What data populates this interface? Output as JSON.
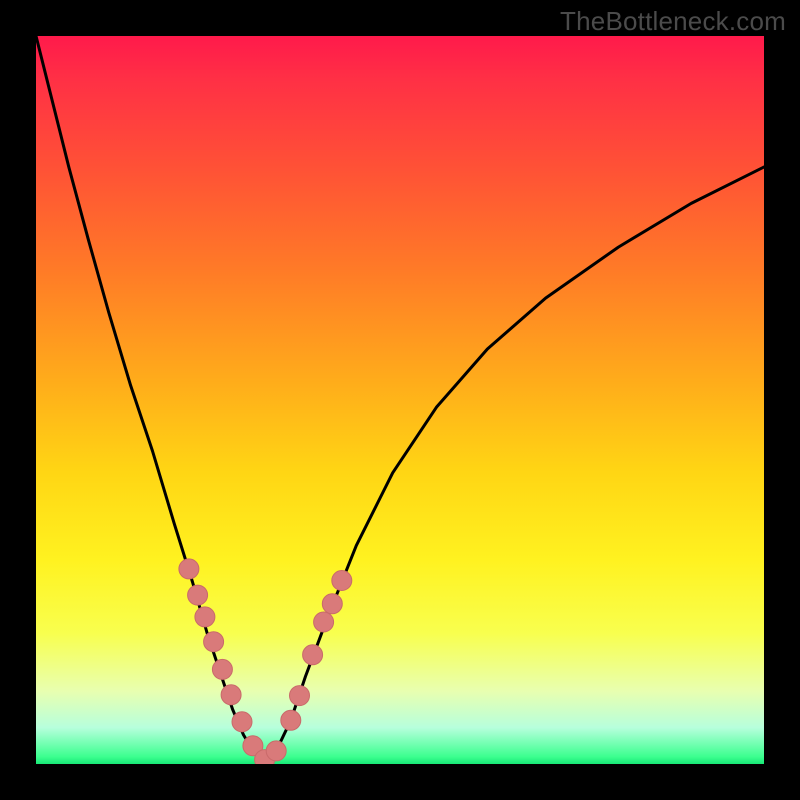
{
  "watermark": "TheBottleneck.com",
  "colors": {
    "page_bg": "#000000",
    "curve": "#000000",
    "marker_fill": "#d97a7a",
    "marker_stroke": "#c96a6a",
    "gradient_top": "#ff1a4b",
    "gradient_mid": "#ffe22e",
    "gradient_bottom": "#18e876"
  },
  "chart_data": {
    "type": "line",
    "title": "",
    "xlabel": "",
    "ylabel": "",
    "xlim": [
      0,
      1
    ],
    "ylim": [
      0,
      1
    ],
    "series": [
      {
        "name": "bottleneck-curve",
        "x": [
          0.0,
          0.02,
          0.045,
          0.072,
          0.1,
          0.13,
          0.16,
          0.19,
          0.215,
          0.235,
          0.255,
          0.27,
          0.285,
          0.3,
          0.315,
          0.33,
          0.35,
          0.37,
          0.4,
          0.44,
          0.49,
          0.55,
          0.62,
          0.7,
          0.8,
          0.9,
          1.0
        ],
        "y": [
          1.0,
          0.92,
          0.82,
          0.72,
          0.62,
          0.52,
          0.43,
          0.33,
          0.25,
          0.18,
          0.12,
          0.075,
          0.04,
          0.015,
          0.005,
          0.018,
          0.06,
          0.12,
          0.2,
          0.3,
          0.4,
          0.49,
          0.57,
          0.64,
          0.71,
          0.77,
          0.82
        ]
      }
    ],
    "markers": {
      "name": "highlighted-points",
      "x": [
        0.21,
        0.222,
        0.232,
        0.244,
        0.256,
        0.268,
        0.283,
        0.298,
        0.314,
        0.33,
        0.35,
        0.362,
        0.38,
        0.395,
        0.407,
        0.42
      ],
      "y": [
        0.268,
        0.232,
        0.202,
        0.168,
        0.13,
        0.095,
        0.058,
        0.025,
        0.006,
        0.018,
        0.06,
        0.094,
        0.15,
        0.195,
        0.22,
        0.252
      ]
    }
  }
}
